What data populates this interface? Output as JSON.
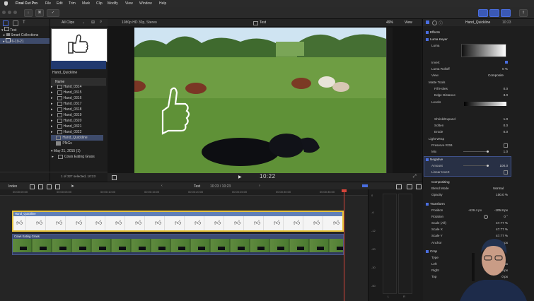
{
  "menubar": {
    "apple": "",
    "items": [
      "Final Cut Pro",
      "File",
      "Edit",
      "Trim",
      "Mark",
      "Clip",
      "Modify",
      "View",
      "Window",
      "Help"
    ]
  },
  "browser": {
    "filter": "All Clips",
    "library_name": "Test",
    "smart_collections": "Smart Collections",
    "event": "6-19-21",
    "thumbnail_label": "Hand_Quickline",
    "column_header": "Name",
    "items": [
      "Hand_0314",
      "Hand_0315",
      "Hand_0316",
      "Hand_0317",
      "Hand_0318",
      "Hand_0319",
      "Hand_0320",
      "Hand_0321",
      "Hand_0322",
      "Hand_Quickline",
      "PNGs"
    ],
    "date_group": "May 21, 2015  (1)",
    "date_item": "Cows Eating Grass",
    "status": "1 of 327 selected, 10:23"
  },
  "viewer": {
    "format": "1080p HD 30p, Stereo",
    "project": "Test",
    "zoom": "49%",
    "view_label": "View",
    "timecode": "10:22"
  },
  "timeline": {
    "index_label": "Index",
    "project": "Test",
    "duration": "10:23 / 10:23",
    "clip1_name": "Hand_Quickline",
    "clip2_name": "Cows Eating Grass",
    "ruler": [
      "00:00:00:00",
      "00:00:05:00",
      "00:00:10:00",
      "00:00:15:00",
      "00:00:20:00",
      "00:00:25:00",
      "00:00:30:00",
      "00:00:35:00"
    ],
    "meter_labels": [
      "0",
      "-6",
      "-12",
      "-20",
      "-30",
      "-50"
    ],
    "meter_lr": [
      "L",
      "R"
    ]
  },
  "inspector": {
    "clip": "Hand_Quickline",
    "timecode": "10:23",
    "effects_header": "Effects",
    "luma_keyer": "Luma Keyer",
    "rows": [
      {
        "label": "Luma",
        "value": ""
      },
      {
        "label": "Invert",
        "value": ""
      },
      {
        "label": "Luma Rolloff",
        "value": "0 %"
      },
      {
        "label": "View",
        "value": "Composite"
      },
      {
        "label": "Matte Tools",
        "value": ""
      },
      {
        "label": "Fill Holes",
        "value": "0.0"
      },
      {
        "label": "Edge Distance",
        "value": "3.0"
      },
      {
        "label": "Levels",
        "value": ""
      },
      {
        "label": "Shrink/Expand",
        "value": "1.0"
      },
      {
        "label": "Soften",
        "value": "0.0"
      },
      {
        "label": "Erode",
        "value": "0.0"
      },
      {
        "label": "Light Wrap",
        "value": ""
      },
      {
        "label": "Preserve RGB",
        "value": ""
      },
      {
        "label": "Mix",
        "value": "1.0"
      }
    ],
    "negative": "Negative",
    "amount_label": "Amount",
    "amount_value": "100.0",
    "linear_invert": "Linear Invert",
    "compositing": "Compositing",
    "blend_label": "Blend Mode",
    "blend_value": "Normal",
    "opacity_label": "Opacity",
    "opacity_value": "100.0 %",
    "transform": "Transform",
    "position_label": "Position",
    "position_x": "-629.4 px",
    "position_y": "-105.8 px",
    "rotation_label": "Rotation",
    "rotation_value": "0 °",
    "scale_all_label": "Scale (All)",
    "scale_all_value": "47.77 %",
    "scale_x_label": "Scale X",
    "scale_x_value": "47.77 %",
    "scale_y_label": "Scale Y",
    "scale_y_value": "47.77 %",
    "anchor_label": "Anchor",
    "anchor_value": "0 px",
    "crop": "Crop",
    "type_label": "Type",
    "type_value": "Trim",
    "left_label": "Left",
    "left_value": "0 px",
    "right_label": "Right",
    "right_value": "0 px",
    "top_label": "Top",
    "top_value": "0 px"
  },
  "colors": {
    "accent": "#4a6ee0",
    "playhead": "#d7453a",
    "clip_border": "#e6c23a",
    "selection": "#3e4b6b"
  }
}
